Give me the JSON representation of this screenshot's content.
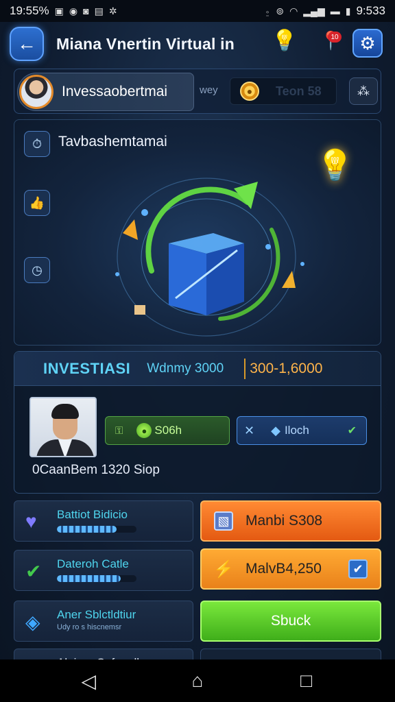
{
  "status_bar": {
    "time_left": "19:55%",
    "time_right": "9:533"
  },
  "header": {
    "title": "Miana Vnertin Virtual in",
    "notif_count": "10"
  },
  "profile": {
    "name": "Invessaobertmai",
    "wey_label": "wey",
    "coin_value": "Teon 58"
  },
  "hero": {
    "title": "Tavbashemtamai"
  },
  "invest": {
    "title": "INVESTIASI",
    "subtitle": "Wdnmy 3000",
    "range": "300-1,6000",
    "green_label": "S06h",
    "blue_label": "Iloch",
    "caption": "0CaanBem 1320 Siop"
  },
  "left_cards": [
    {
      "label": "Battiot Bidicio",
      "progress": 0.75,
      "sub": ""
    },
    {
      "label": "Dateroh Catle",
      "progress": 0.8,
      "sub": ""
    },
    {
      "label": "Aner Sblctldtiur",
      "progress": 0,
      "sub": "Udy ro s hiscnemsr"
    },
    {
      "label": "Aleiner Cnfngelh",
      "progress": 0,
      "sub": ""
    }
  ],
  "right_buttons": {
    "orange1": "Manbi S308",
    "orange2": "MalvB4,250",
    "green": "Sbuck"
  },
  "colors": {
    "accent_cyan": "#5fd3f6",
    "accent_orange": "#ffb44a",
    "button_green": "#4fbf22",
    "button_orange": "#f07020"
  }
}
